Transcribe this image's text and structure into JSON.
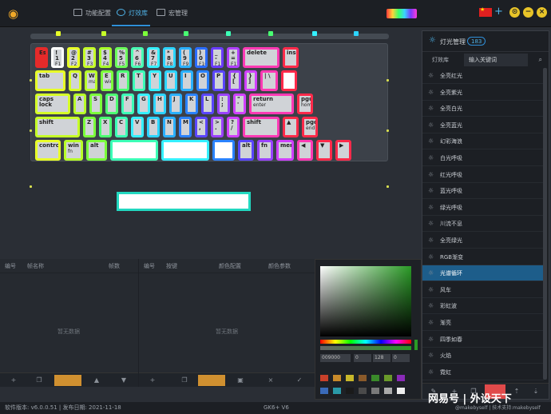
{
  "nav": {
    "tabs": [
      {
        "label": "功能配置",
        "icon": "keyboard-icon"
      },
      {
        "label": "灯效库",
        "icon": "light-icon"
      },
      {
        "label": "宏管理",
        "icon": "document-icon"
      }
    ],
    "active_tab": "灯效库",
    "plus": "+",
    "minimize_label": "−",
    "close_label": "×"
  },
  "colors": {
    "accent": "#2f8fd8",
    "selected_effect": "#1d5d8a",
    "picker_color": "#2a9a26"
  },
  "keyboard": {
    "rows": [
      [
        {
          "t": "Esc",
          "c": "#e62a2a"
        },
        {
          "t": "! 1",
          "s": "F1",
          "c": "#ffffff"
        },
        {
          "t": "@ 2",
          "s": "F2",
          "c": "#e8ff28"
        },
        {
          "t": "# 3",
          "s": "F3",
          "c": "#c6ff28"
        },
        {
          "t": "$ 4",
          "s": "F4",
          "c": "#a8ff28"
        },
        {
          "t": "% 5",
          "s": "F5",
          "c": "#6cff5a"
        },
        {
          "t": "^ 6",
          "s": "F6",
          "c": "#48ffb4"
        },
        {
          "t": "& 7",
          "s": "F7",
          "c": "#34f0ff"
        },
        {
          "t": "* 8",
          "s": "F8",
          "c": "#2cd4ff"
        },
        {
          "t": "( 9",
          "s": "F9",
          "c": "#2ab0ff"
        },
        {
          "t": ") 0",
          "s": "F10",
          "c": "#2a6cff"
        },
        {
          "t": "_ -",
          "s": "F11",
          "c": "#6a3cff"
        },
        {
          "t": "+ =",
          "s": "F12",
          "c": "#b040ff"
        },
        {
          "t": "delete",
          "c": "#ff3ab4"
        },
        {
          "t": "insert",
          "c": "#ff2a4a"
        }
      ],
      [
        {
          "t": "tab",
          "c": "#e8ff28"
        },
        {
          "t": "Q",
          "c": "#d6ff28"
        },
        {
          "t": "W",
          "s": "mac",
          "c": "#b8ff28"
        },
        {
          "t": "E",
          "s": "win",
          "c": "#7cff3a"
        },
        {
          "t": "R",
          "c": "#4cff72"
        },
        {
          "t": "T",
          "c": "#3cffb6"
        },
        {
          "t": "Y",
          "c": "#34f0ff"
        },
        {
          "t": "U",
          "c": "#2cd4ff"
        },
        {
          "t": "I",
          "c": "#2ab0ff"
        },
        {
          "t": "O",
          "c": "#2a82ff"
        },
        {
          "t": "P",
          "c": "#5a46ff"
        },
        {
          "t": "{ [",
          "c": "#9a42ff"
        },
        {
          "t": "} ]",
          "c": "#d040ff"
        },
        {
          "t": "| \\",
          "c": "#ff3ab4"
        },
        {
          "t": "",
          "c": "#ff2a4a"
        }
      ],
      [
        {
          "t": "caps lock",
          "c": "#d6ff28"
        },
        {
          "t": "A",
          "c": "#b8ff28"
        },
        {
          "t": "S",
          "c": "#7cff3a"
        },
        {
          "t": "D",
          "c": "#4cff72"
        },
        {
          "t": "F",
          "c": "#3cffb6"
        },
        {
          "t": "G",
          "c": "#34f0ff"
        },
        {
          "t": "H",
          "c": "#2cd4ff"
        },
        {
          "t": "J",
          "c": "#2ab0ff"
        },
        {
          "t": "K",
          "c": "#2a82ff"
        },
        {
          "t": "L",
          "c": "#5a46ff"
        },
        {
          "t": ": ;",
          "c": "#9a42ff"
        },
        {
          "t": "\" '",
          "c": "#d040ff"
        },
        {
          "t": "return",
          "s": "enter",
          "c": "#ff3ab4"
        },
        {
          "t": "pgup",
          "s": "home",
          "c": "#ff2a4a"
        }
      ],
      [
        {
          "t": "shift",
          "c": "#c6ff28"
        },
        {
          "t": "Z",
          "c": "#7cff3a"
        },
        {
          "t": "X",
          "c": "#4cff72"
        },
        {
          "t": "C",
          "c": "#3cffb6"
        },
        {
          "t": "V",
          "c": "#34f0ff"
        },
        {
          "t": "B",
          "c": "#2cd4ff"
        },
        {
          "t": "N",
          "c": "#2ab0ff"
        },
        {
          "t": "M",
          "c": "#2a82ff"
        },
        {
          "t": "< ,",
          "c": "#5a46ff"
        },
        {
          "t": "> .",
          "c": "#9a42ff"
        },
        {
          "t": "? /",
          "c": "#d040ff"
        },
        {
          "t": "shift",
          "c": "#ff3ab4"
        },
        {
          "t": "▲",
          "c": "#ff2a4a"
        },
        {
          "t": "pgdn",
          "s": "end",
          "c": "#ff2a4a"
        }
      ],
      [
        {
          "t": "control",
          "c": "#e8ff28"
        },
        {
          "t": "win",
          "s": "fn",
          "c": "#b8ff28"
        },
        {
          "t": "alt",
          "c": "#7cff3a"
        },
        {
          "t": "",
          "c": "#3cffb6"
        },
        {
          "t": "",
          "c": "#34f0ff"
        },
        {
          "t": "",
          "c": "#2a82ff"
        },
        {
          "t": "alt",
          "c": "#5a46ff"
        },
        {
          "t": "fn",
          "c": "#9a42ff"
        },
        {
          "t": "menu",
          "c": "#d040ff"
        },
        {
          "t": "◀",
          "c": "#ff3ab4"
        },
        {
          "t": "▼",
          "c": "#ff2a4a"
        },
        {
          "t": "▶",
          "c": "#ff2a4a"
        }
      ]
    ]
  },
  "frames_panel": {
    "columns": [
      "编号",
      "帧名称",
      "帧数"
    ],
    "empty": "暂无数据"
  },
  "colors_panel": {
    "columns": [
      "编号",
      "按键",
      "颜色配置",
      "颜色参数"
    ],
    "empty": "暂无数据"
  },
  "picker": {
    "hex": "009000",
    "r": "0",
    "g": "128",
    "b": "0"
  },
  "sidebar": {
    "title": "灯光管理",
    "count": "183",
    "tabs": [
      "灯效库",
      "输入关键词"
    ],
    "effects": [
      "全亮红光",
      "全亮紫光",
      "全亮白光",
      "全亮蓝光",
      "幻彩海浪",
      "白光呼吸",
      "红光呼吸",
      "蓝光呼吸",
      "绿光呼吸",
      "川流不息",
      "全亮绿光",
      "RGB渐变",
      "光谱循环",
      "风车",
      "彩虹波",
      "渐亮",
      "四季如春",
      "火焰",
      "霓虹"
    ],
    "selected": "光谱循环"
  },
  "status": {
    "version": "软件版本: v6.0.0.51 | 发布日期: 2021-11-18",
    "device": "GK6+ V6",
    "watermark": "网易号 | 外设天下",
    "credit": "@makebyself | 技术支持:makebyself"
  }
}
